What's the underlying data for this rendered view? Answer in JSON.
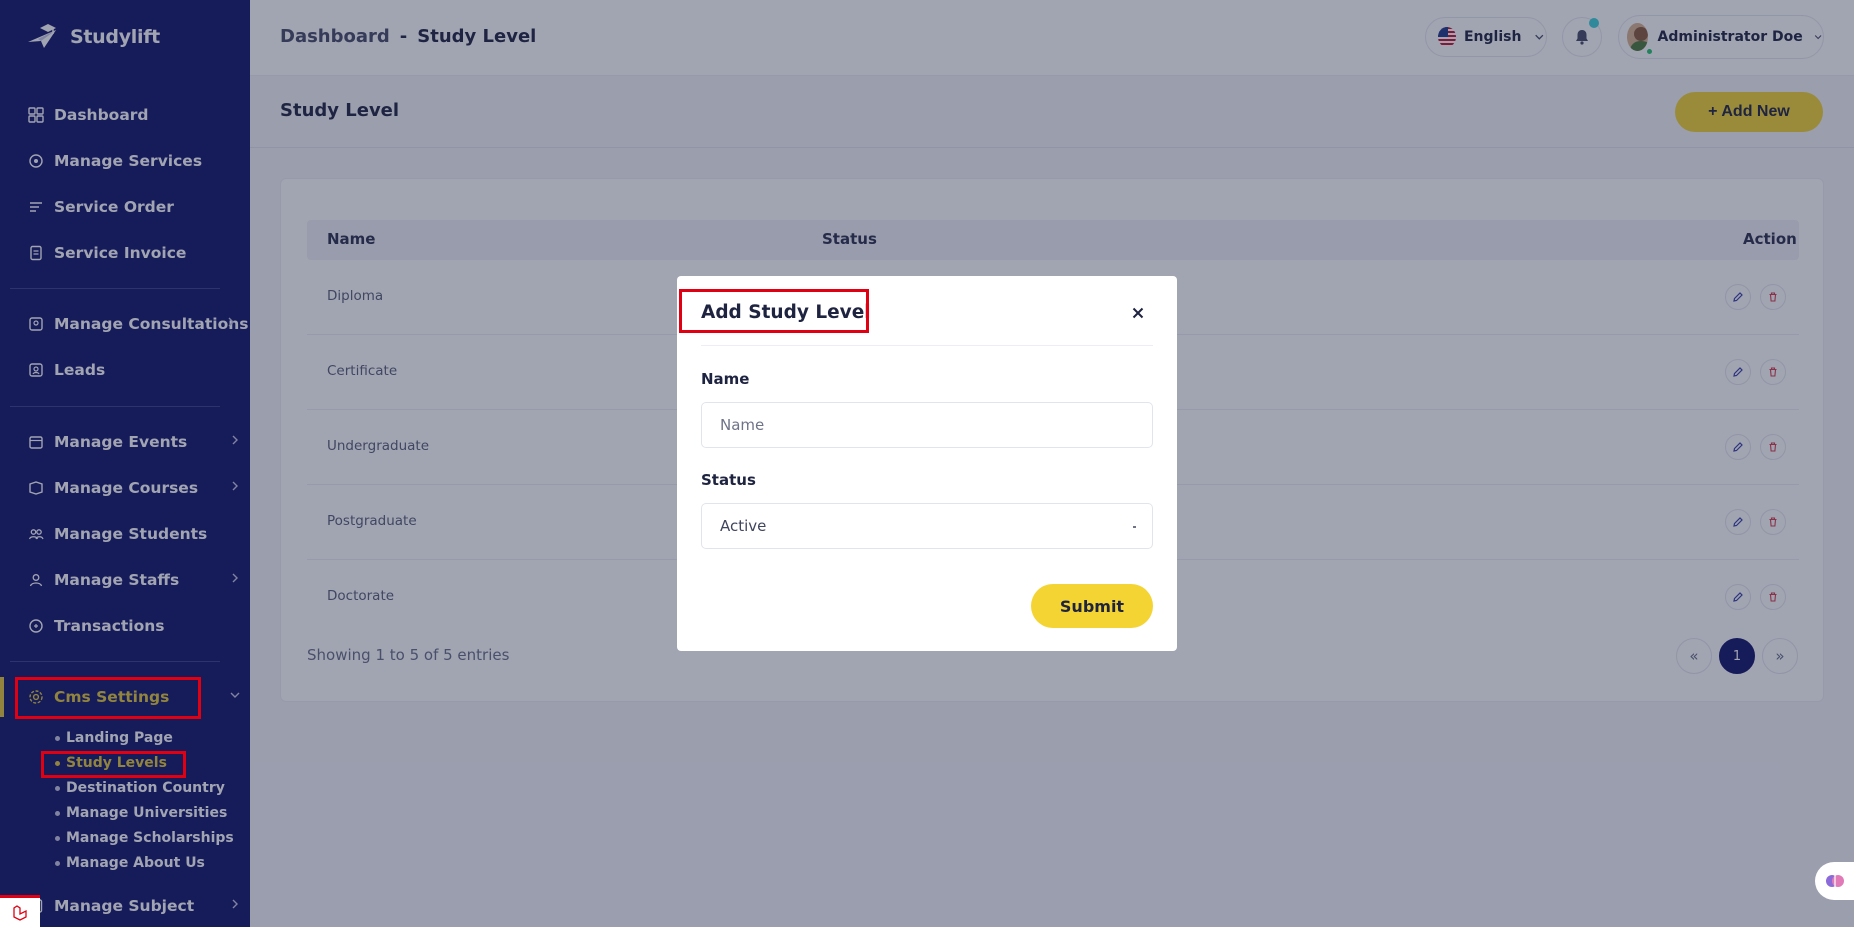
{
  "app": {
    "name": "Studylift"
  },
  "sidebar": {
    "items": [
      {
        "label": "Dashboard"
      },
      {
        "label": "Manage Services"
      },
      {
        "label": "Service Order"
      },
      {
        "label": "Service Invoice"
      },
      {
        "label": "Manage Consultations"
      },
      {
        "label": "Leads"
      },
      {
        "label": "Manage Events"
      },
      {
        "label": "Manage Courses"
      },
      {
        "label": "Manage Students"
      },
      {
        "label": "Manage Staffs"
      },
      {
        "label": "Transactions"
      },
      {
        "label": "Cms Settings"
      },
      {
        "label": "Manage Subject"
      }
    ],
    "cms_sub": [
      {
        "label": "Landing Page"
      },
      {
        "label": "Study Levels"
      },
      {
        "label": "Destination Country"
      },
      {
        "label": "Manage Universities"
      },
      {
        "label": "Manage Scholarships"
      },
      {
        "label": "Manage About Us"
      }
    ]
  },
  "header": {
    "breadcrumb": {
      "parent": "Dashboard",
      "separator": "-",
      "current": "Study Level"
    },
    "language": "English",
    "user_name": "Administrator Doe"
  },
  "page": {
    "title": "Study Level",
    "add_button": "+ Add New",
    "table": {
      "columns": [
        "Name",
        "Status",
        "Action"
      ],
      "rows": [
        {
          "name": "Diploma"
        },
        {
          "name": "Certificate"
        },
        {
          "name": "Undergraduate"
        },
        {
          "name": "Postgraduate"
        },
        {
          "name": "Doctorate"
        }
      ]
    },
    "showing": "Showing 1 to 5 of 5 entries",
    "pagination": {
      "prev": "«",
      "current": "1",
      "next": "»"
    }
  },
  "modal": {
    "title": "Add Study Level",
    "name_label": "Name",
    "name_placeholder": "Name",
    "name_value": "",
    "status_label": "Status",
    "status_value": "Active",
    "submit": "Submit"
  },
  "colors": {
    "sidebar_bg": "#10136a",
    "accent": "#f3d432",
    "active_text": "#e4c93a",
    "highlight": "#e00012"
  }
}
